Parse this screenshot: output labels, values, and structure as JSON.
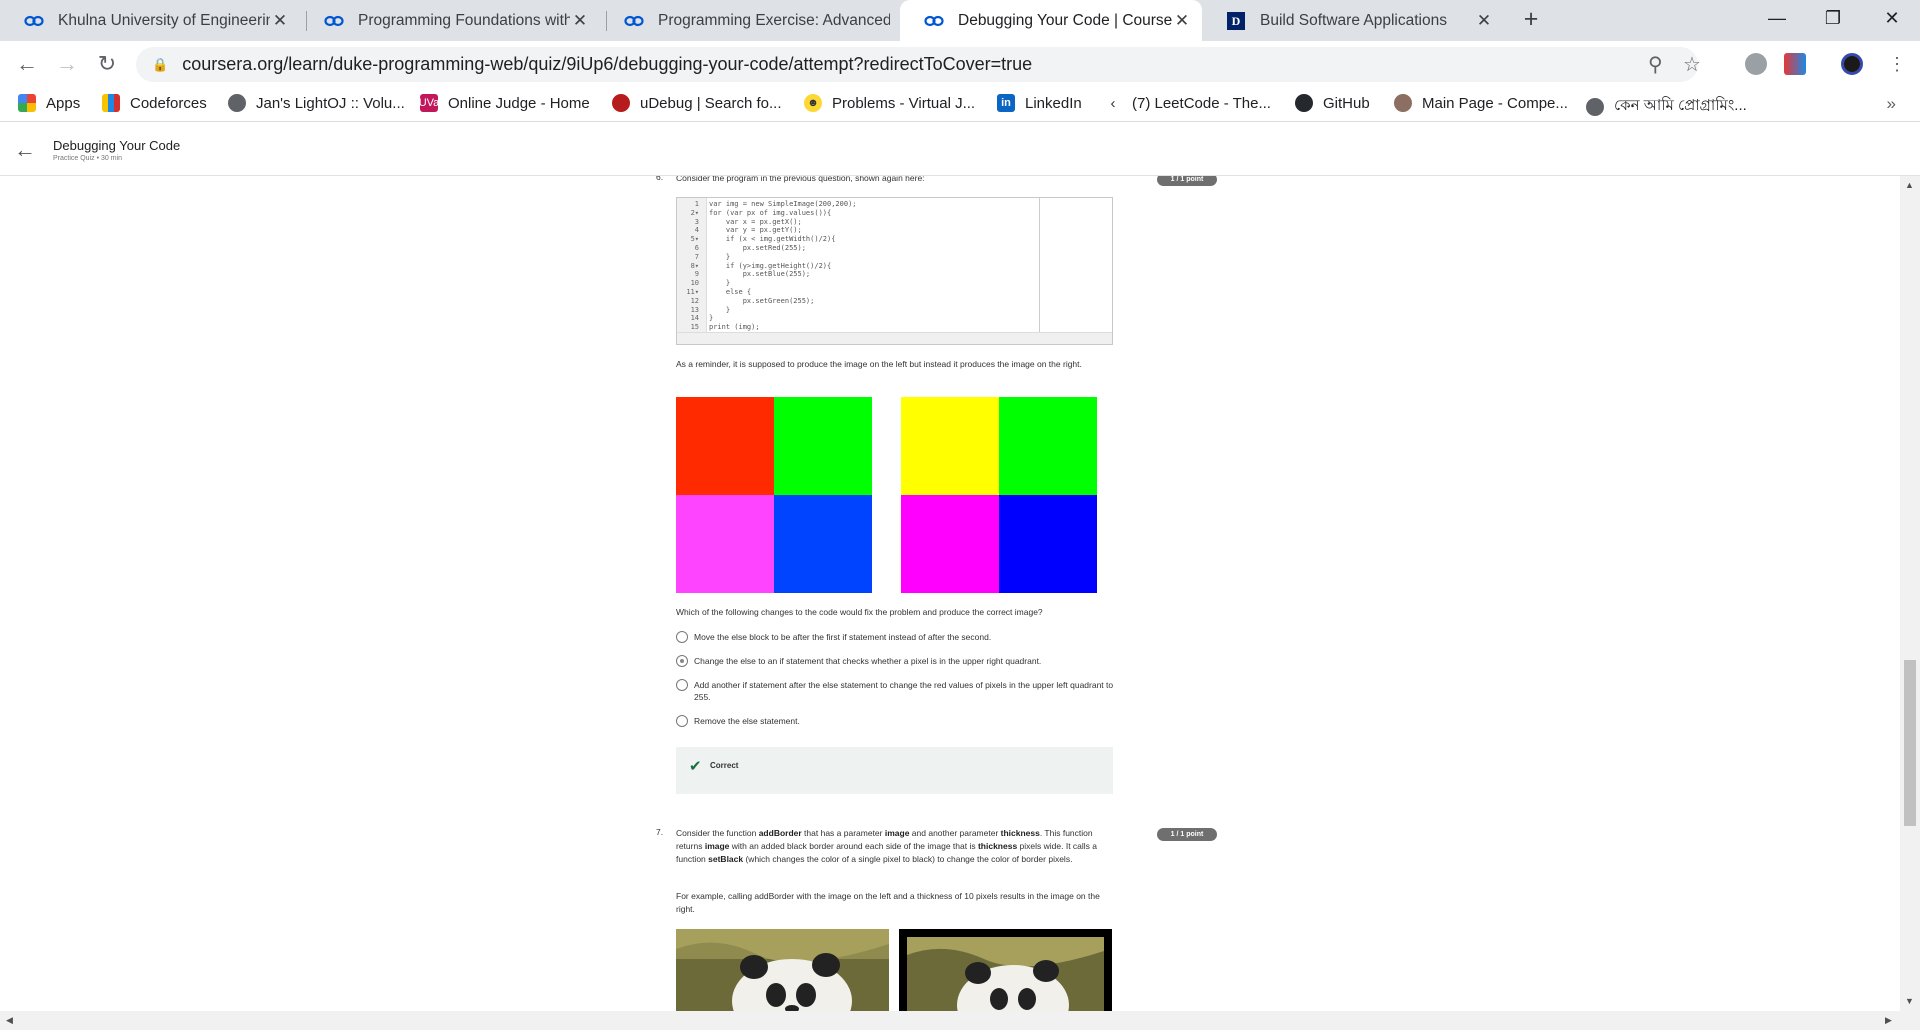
{
  "browser": {
    "tabs": [
      {
        "title": "Khulna University of Engineering",
        "icon": "coursera-icon",
        "active": false
      },
      {
        "title": "Programming Foundations with J",
        "icon": "coursera-icon",
        "active": false
      },
      {
        "title": "Programming Exercise: Advanced",
        "icon": "coursera-icon",
        "active": false
      },
      {
        "title": "Debugging Your Code | Coursera",
        "icon": "coursera-icon",
        "active": true
      },
      {
        "title": "Build Software Applications",
        "icon": "duke-icon",
        "active": false
      }
    ],
    "url": "coursera.org/learn/duke-programming-web/quiz/9iUp6/debugging-your-code/attempt?redirectToCover=true",
    "bookmarks": [
      {
        "label": "Apps"
      },
      {
        "label": "Codeforces"
      },
      {
        "label": "Jan's LightOJ :: Volu..."
      },
      {
        "label": "Online Judge - Home"
      },
      {
        "label": "uDebug | Search fo..."
      },
      {
        "label": "Problems - Virtual J..."
      },
      {
        "label": "LinkedIn"
      },
      {
        "label": "(7) LeetCode - The..."
      },
      {
        "label": "GitHub"
      },
      {
        "label": "Main Page - Compe..."
      },
      {
        "label": "কেন আমি প্রোগ্রামিং..."
      }
    ]
  },
  "header": {
    "title": "Debugging Your Code",
    "subtitle": "Practice Quiz • 30 min"
  },
  "q6": {
    "number": "6.",
    "prompt": "Consider the program in the previous question, shown again here:",
    "badge": "1 / 1 point",
    "code": [
      {
        "n": "1",
        "text": "var img = new SimpleImage(200,200);"
      },
      {
        "n": "2▾",
        "text": "for (var px of img.values()){"
      },
      {
        "n": "3",
        "text": "    var x = px.getX();"
      },
      {
        "n": "4",
        "text": "    var y = px.getY();"
      },
      {
        "n": "5▾",
        "text": "    if (x < img.getWidth()/2){"
      },
      {
        "n": "6",
        "text": "        px.setRed(255);"
      },
      {
        "n": "7",
        "text": "    }"
      },
      {
        "n": "8▾",
        "text": "    if (y>img.getHeight()/2){"
      },
      {
        "n": "9",
        "text": "        px.setBlue(255);"
      },
      {
        "n": "10",
        "text": "    }"
      },
      {
        "n": "11▾",
        "text": "    else {"
      },
      {
        "n": "12",
        "text": "        px.setGreen(255);"
      },
      {
        "n": "13",
        "text": "    }"
      },
      {
        "n": "14",
        "text": "}"
      },
      {
        "n": "15",
        "text": "print (img);"
      }
    ],
    "reminder": "As a reminder, it is supposed to produce the image on the left but instead it produces the image on the right.",
    "question": "Which of the following changes to the code would fix the problem and produce the correct image?",
    "options": [
      {
        "text": "Move the else block to be after the first if statement instead of after the second.",
        "checked": false
      },
      {
        "text": "Change the else to an if statement that checks whether a pixel is in the upper right quadrant.",
        "checked": true
      },
      {
        "text": "Add another if statement after the else statement to change the red values of pixels in the upper left quadrant to 255.",
        "checked": false
      },
      {
        "text": "Remove the else statement.",
        "checked": false
      }
    ],
    "feedback": "Correct",
    "colors": {
      "expected": [
        "#ff2a00",
        "#00ff00",
        "#ff44ff",
        "#0044ff"
      ],
      "actual": [
        "#ffff00",
        "#00ff00",
        "#ff00ff",
        "#0000ff"
      ]
    }
  },
  "q7": {
    "number": "7.",
    "text_before_1": "Consider the function ",
    "bold_1": "addBorder",
    "text_before_2": " that has a parameter ",
    "bold_2": "image",
    "text_before_3": " and another parameter ",
    "bold_3": "thickness",
    "text_before_4": ". This function returns ",
    "bold_4": "image",
    "text_before_5": " with an added black border around each side of the image that is ",
    "bold_5": "thickness",
    "text_before_6": " pixels wide. It calls a function ",
    "bold_6": "setBlack",
    "text_before_7": " (which changes the color of a single pixel to black) to change the color of border pixels.",
    "example": "For example, calling addBorder with the image on the left and a thickness of 10 pixels results in the image on the right.",
    "badge": "1 / 1 point"
  }
}
